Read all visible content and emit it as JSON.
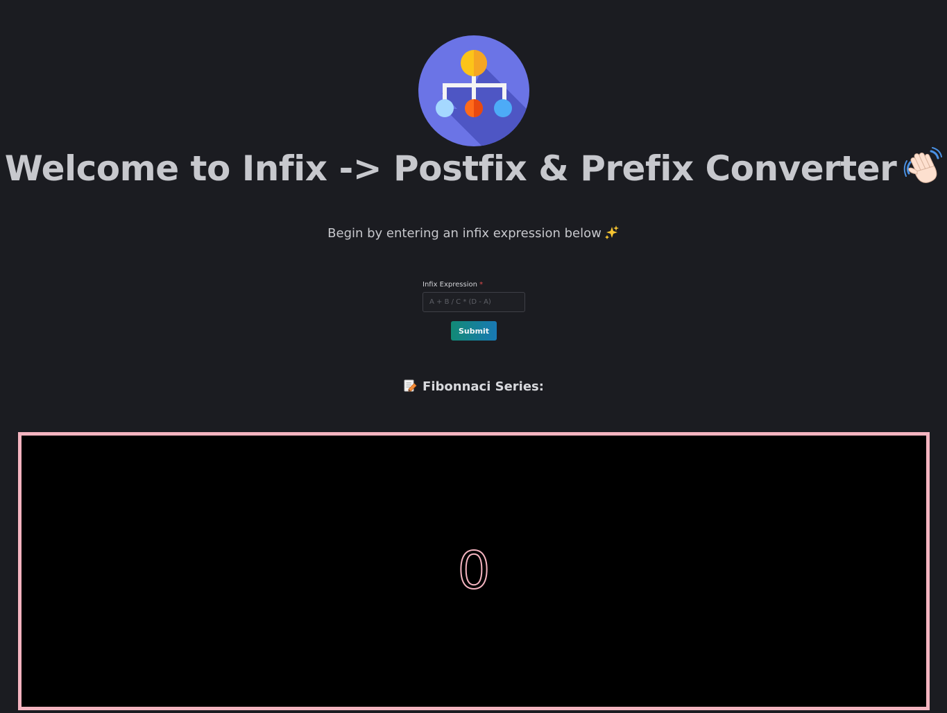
{
  "header": {
    "logo_icon": "hierarchy-tree-icon",
    "title": "Welcome to Infix -> Postfix & Prefix Converter",
    "title_icon": "waving-hand-icon",
    "subtitle": "Begin by entering an infix expression below",
    "subtitle_icon": "sparkles-icon"
  },
  "form": {
    "label": "Infix Expression",
    "required_mark": "*",
    "placeholder": "A + B / C * (D - A)",
    "value": "",
    "submit_label": "Submit"
  },
  "fibonacci": {
    "heading_icon": "memo-icon",
    "heading": "Fibonnaci Series:",
    "current_value": "0"
  },
  "colors": {
    "background": "#1b1c21",
    "text": "#c7c8cd",
    "border_accent": "#f4b4c0",
    "button_start": "#128a76",
    "button_end": "#1979b4",
    "required": "#e24c4c"
  }
}
